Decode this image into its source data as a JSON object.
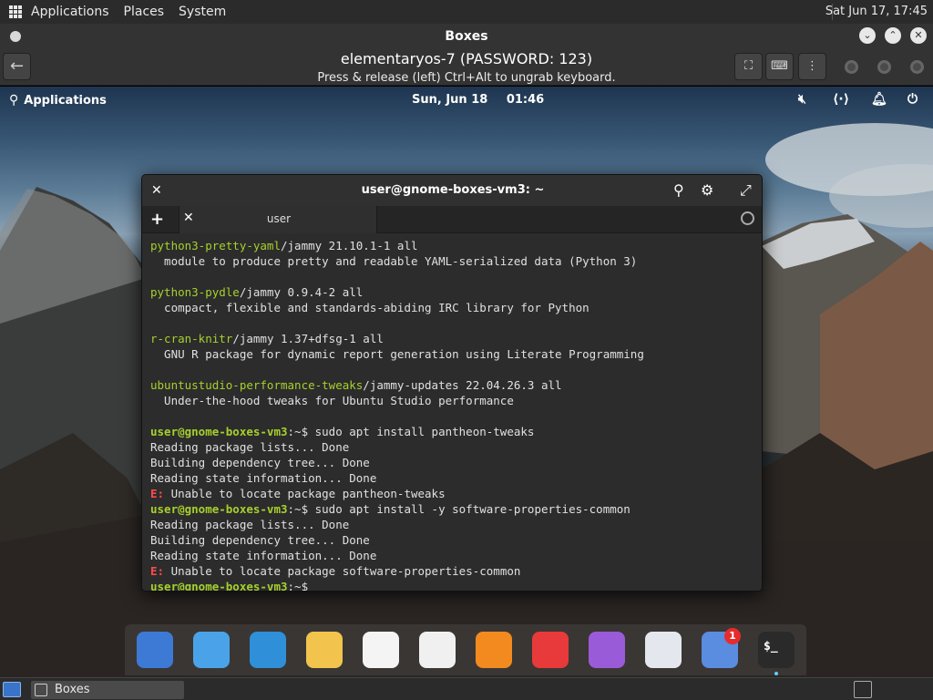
{
  "host_panel": {
    "menus": [
      "Applications",
      "Places",
      "System"
    ],
    "clock": "Sat Jun 17, 17:45"
  },
  "boxes_window": {
    "title": "Boxes",
    "vm_title": "elementaryos-7 (PASSWORD: 123)",
    "vm_hint": "Press & release (left) Ctrl+Alt to ungrab keyboard."
  },
  "guest_panel": {
    "applications_label": "Applications",
    "date": "Sun, Jun 18",
    "time": "01:46"
  },
  "terminal": {
    "title": "user@gnome-boxes-vm3: ~",
    "tab_label": "user",
    "lines": [
      {
        "kind": "pkg",
        "name": "python3-pretty-yaml",
        "rest": "/jammy 21.10.1-1 all"
      },
      {
        "kind": "text",
        "text": "  module to produce pretty and readable YAML-serialized data (Python 3)"
      },
      {
        "kind": "blank"
      },
      {
        "kind": "pkg",
        "name": "python3-pydle",
        "rest": "/jammy 0.9.4-2 all"
      },
      {
        "kind": "text",
        "text": "  compact, flexible and standards-abiding IRC library for Python"
      },
      {
        "kind": "blank"
      },
      {
        "kind": "pkg",
        "name": "r-cran-knitr",
        "rest": "/jammy 1.37+dfsg-1 all"
      },
      {
        "kind": "text",
        "text": "  GNU R package for dynamic report generation using Literate Programming"
      },
      {
        "kind": "blank"
      },
      {
        "kind": "pkg",
        "name": "ubuntustudio-performance-tweaks",
        "rest": "/jammy-updates 22.04.26.3 all"
      },
      {
        "kind": "text",
        "text": "  Under-the-hood tweaks for Ubuntu Studio performance"
      },
      {
        "kind": "blank"
      },
      {
        "kind": "prompt",
        "prompt": "user@gnome-boxes-vm3",
        "rest": ":~$ sudo apt install pantheon-tweaks"
      },
      {
        "kind": "text",
        "text": "Reading package lists... Done"
      },
      {
        "kind": "text",
        "text": "Building dependency tree... Done"
      },
      {
        "kind": "text",
        "text": "Reading state information... Done"
      },
      {
        "kind": "error",
        "prefix": "E:",
        "rest": " Unable to locate package pantheon-tweaks"
      },
      {
        "kind": "prompt",
        "prompt": "user@gnome-boxes-vm3",
        "rest": ":~$ sudo apt install -y software-properties-common"
      },
      {
        "kind": "text",
        "text": "Reading package lists... Done"
      },
      {
        "kind": "text",
        "text": "Building dependency tree... Done"
      },
      {
        "kind": "text",
        "text": "Reading state information... Done"
      },
      {
        "kind": "error",
        "prefix": "E:",
        "rest": " Unable to locate package software-properties-common"
      },
      {
        "kind": "prompt",
        "prompt": "user@gnome-boxes-vm3",
        "rest": ":~$ "
      }
    ]
  },
  "dock": {
    "icons": [
      {
        "name": "multitasking-view-icon",
        "bg": "#3d7ad6"
      },
      {
        "name": "files-icon",
        "bg": "#4aa3e8"
      },
      {
        "name": "web-browser-icon",
        "bg": "#2f8fd8"
      },
      {
        "name": "mail-icon",
        "bg": "#f2c44d"
      },
      {
        "name": "tasks-icon",
        "bg": "#f4f4f4"
      },
      {
        "name": "calendar-icon",
        "bg": "#f0f0f0"
      },
      {
        "name": "music-icon",
        "bg": "#f28a1f"
      },
      {
        "name": "videos-icon",
        "bg": "#e83a3a"
      },
      {
        "name": "photos-icon",
        "bg": "#9a5bd8"
      },
      {
        "name": "system-settings-icon",
        "bg": "#e4e8ee"
      },
      {
        "name": "appcenter-icon",
        "bg": "#5a8ce0",
        "badge": "1"
      },
      {
        "name": "terminal-icon",
        "bg": "#2a2a2a"
      }
    ]
  },
  "taskbar": {
    "task_label": "Boxes"
  }
}
